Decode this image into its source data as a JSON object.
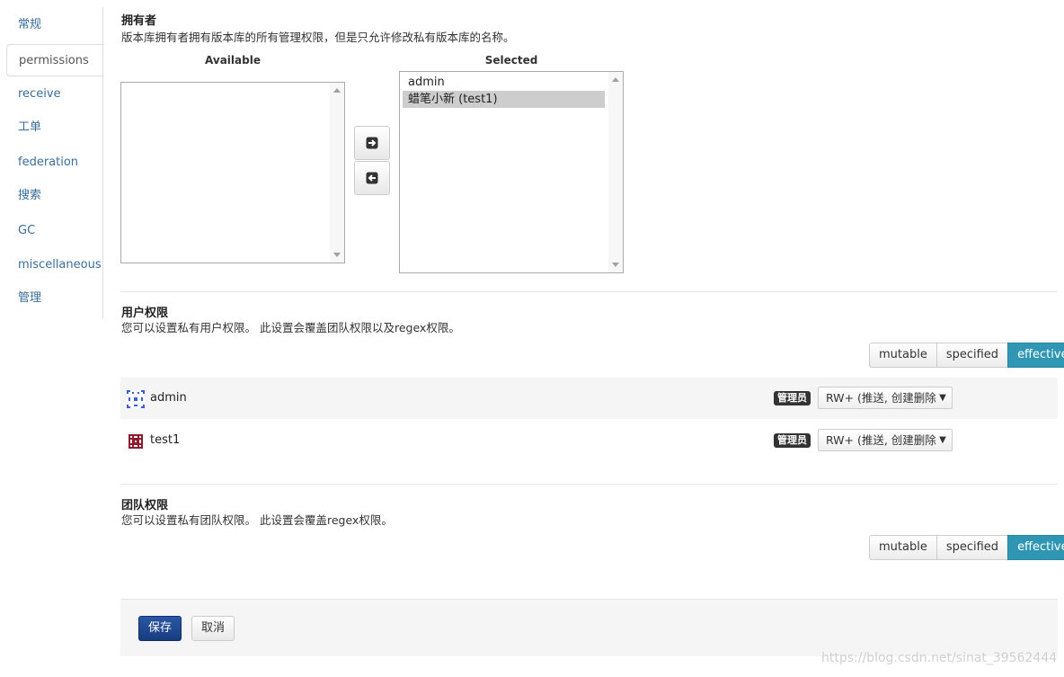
{
  "sidebar": {
    "items": [
      {
        "label": "常规"
      },
      {
        "label": "permissions"
      },
      {
        "label": "receive"
      },
      {
        "label": "工单"
      },
      {
        "label": "federation"
      },
      {
        "label": "搜索"
      },
      {
        "label": "GC"
      },
      {
        "label": "miscellaneous"
      },
      {
        "label": "管理"
      }
    ],
    "active": "permissions"
  },
  "owner": {
    "title": "拥有者",
    "description": "版本库拥有者拥有版本库的所有管理权限，但是只允许修改私有版本库的名称。",
    "available_label": "Available",
    "selected_label": "Selected",
    "selected_items": [
      "admin",
      "蜡笔小新 (test1)"
    ],
    "highlighted": "蜡笔小新 (test1)"
  },
  "user_permissions": {
    "title": "用户权限",
    "description": "您可以设置私有用户权限。 此设置会覆盖团队权限以及regex权限。",
    "toggle": {
      "mutable": "mutable",
      "specified": "specified",
      "effective": "effective"
    },
    "rows": [
      {
        "name": "admin",
        "badge": "管理员",
        "permission": "RW+ (推送, 创建删除"
      },
      {
        "name": "test1",
        "badge": "管理员",
        "permission": "RW+ (推送, 创建删除"
      }
    ]
  },
  "team_permissions": {
    "title": "团队权限",
    "description": "您可以设置私有团队权限。 此设置会覆盖regex权限。",
    "toggle": {
      "mutable": "mutable",
      "specified": "specified",
      "effective": "effective"
    }
  },
  "footer": {
    "save_label": "保存",
    "cancel_label": "取消"
  },
  "watermark": "https://blog.csdn.net/sinat_39562444",
  "colors": {
    "accent": "#2f96b4",
    "primary": "#1e4a91",
    "link": "#3a6d9b"
  }
}
